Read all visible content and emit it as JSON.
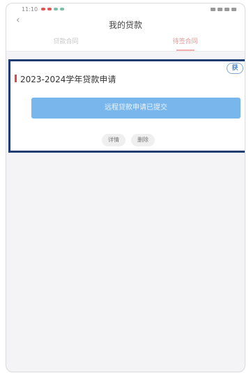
{
  "status_bar": {
    "time": "11:10"
  },
  "header": {
    "back_icon": "chevron-left-icon",
    "title": "我的贷款"
  },
  "tabs": [
    {
      "label": "贷款合同",
      "active": false
    },
    {
      "label": "待签合同",
      "active": true
    }
  ],
  "loan_card": {
    "stamp": "获",
    "title": "2023-2024学年贷款申请",
    "status_button": "远程贷款申请已提交",
    "actions": [
      {
        "label": "详情"
      },
      {
        "label": "删除"
      }
    ]
  },
  "colors": {
    "accent_red": "#d94a4a",
    "tab_active": "#e79a9a",
    "status_button": "#78b6ec",
    "card_outline": "#1f3c73",
    "stamp_blue": "#4f83c6"
  }
}
